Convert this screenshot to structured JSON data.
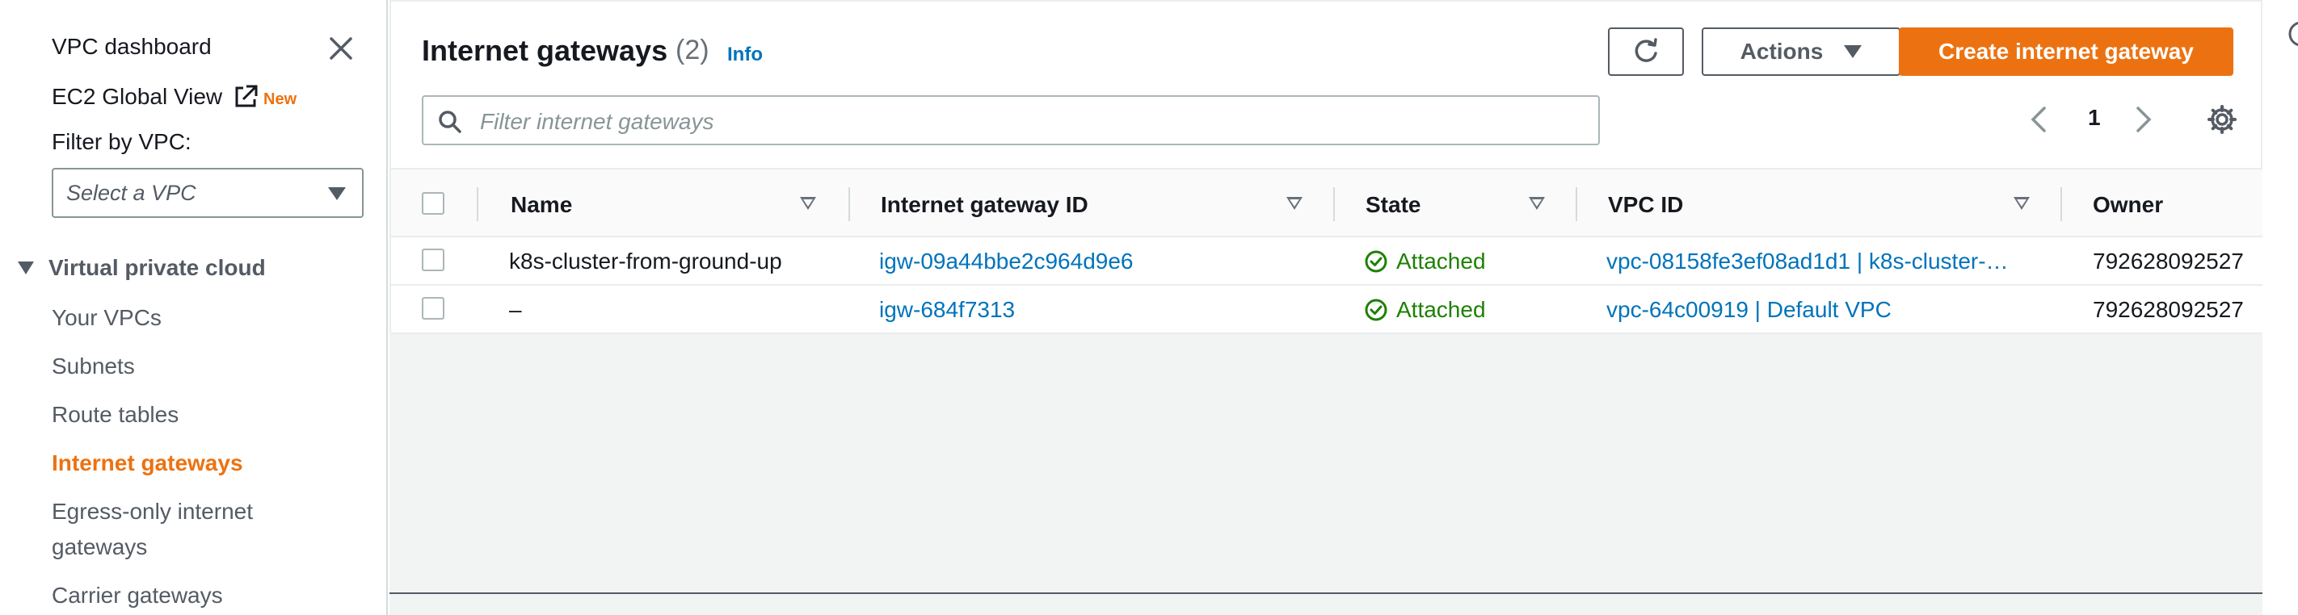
{
  "sidebar": {
    "dashboard_label": "VPC dashboard",
    "global_view_label": "EC2 Global View",
    "new_badge": "New",
    "filter_label": "Filter by VPC:",
    "select_placeholder": "Select a VPC",
    "section_label": "Virtual private cloud",
    "items": [
      {
        "label": "Your VPCs"
      },
      {
        "label": "Subnets"
      },
      {
        "label": "Route tables"
      },
      {
        "label": "Internet gateways",
        "active": true
      },
      {
        "label": "Egress-only internet"
      },
      {
        "label": "gateways"
      },
      {
        "label": "Carrier gateways"
      }
    ]
  },
  "header": {
    "title": "Internet gateways",
    "count": "(2)",
    "info_link": "Info",
    "actions_label": "Actions",
    "create_label": "Create internet gateway"
  },
  "search": {
    "placeholder": "Filter internet gateways"
  },
  "pagination": {
    "current_page": "1"
  },
  "table": {
    "columns": [
      "Name",
      "Internet gateway ID",
      "State",
      "VPC ID",
      "Owner"
    ],
    "rows": [
      {
        "name": "k8s-cluster-from-ground-up",
        "gateway_id": "igw-09a44bbe2c964d9e6",
        "state": "Attached",
        "vpc_id": "vpc-08158fe3ef08ad1d1 | k8s-cluster-…",
        "owner": "792628092527"
      },
      {
        "name": "–",
        "gateway_id": "igw-684f7313",
        "state": "Attached",
        "vpc_id": "vpc-64c00919 | Default VPC",
        "owner": "792628092527"
      }
    ]
  },
  "colors": {
    "accent": "#ec7211",
    "link": "#0073bb",
    "success": "#1d8102"
  },
  "icons": [
    "close-icon",
    "external-link-icon",
    "chevron-down-icon",
    "refresh-icon",
    "search-icon",
    "chevron-left-icon",
    "chevron-right-icon",
    "settings-gear-icon",
    "sort-icon",
    "check-circle-icon",
    "help-icon"
  ]
}
